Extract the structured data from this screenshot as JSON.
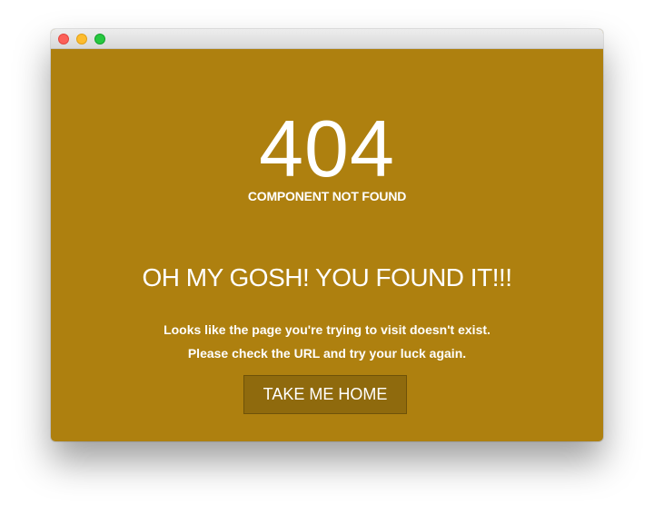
{
  "window": {
    "controls": {
      "close_icon": "close-traffic-light",
      "minimize_icon": "minimize-traffic-light",
      "maximize_icon": "maximize-traffic-light"
    }
  },
  "colors": {
    "background": "#ae800f",
    "button": "#8f6a0d",
    "text": "#ffffff"
  },
  "error": {
    "code": "404",
    "subtitle": "COMPONENT NOT FOUND",
    "headline": "OH MY GOSH! YOU FOUND IT!!!",
    "message_line_1": "Looks like the page you're trying to visit doesn't exist.",
    "message_line_2": "Please check the URL and try your luck again."
  },
  "actions": {
    "home_label": "TAKE ME HOME"
  }
}
